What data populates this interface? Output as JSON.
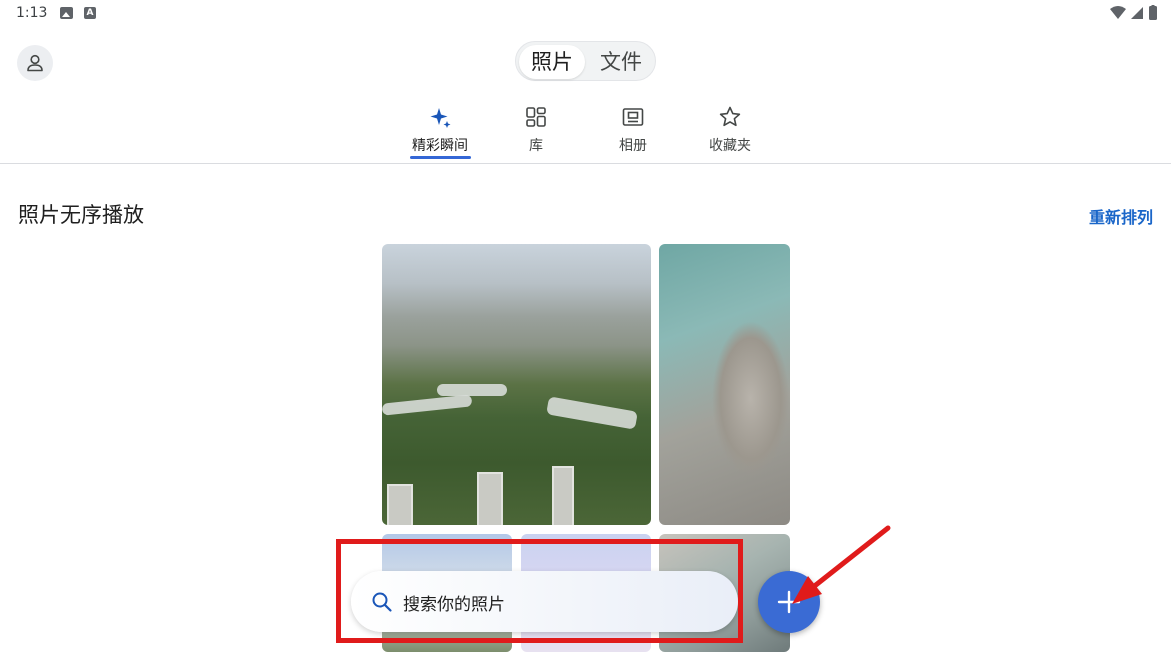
{
  "status_bar": {
    "time": "1:13",
    "icons": [
      "image-notification-icon",
      "a-notification-icon",
      "wifi-icon",
      "cell-signal-icon",
      "battery-icon"
    ]
  },
  "header": {
    "avatar_icon": "person-icon",
    "toggle": {
      "selected": "照片",
      "options": [
        "照片",
        "文件"
      ]
    }
  },
  "tabs": [
    {
      "label": "精彩瞬间",
      "icon": "sparkle-icon",
      "active": true
    },
    {
      "label": "库",
      "icon": "grid-icon",
      "active": false
    },
    {
      "label": "相册",
      "icon": "album-icon",
      "active": false
    },
    {
      "label": "收藏夹",
      "icon": "star-icon",
      "active": false
    }
  ],
  "content": {
    "section_title": "照片无序播放",
    "rearrange_label": "重新排列"
  },
  "search": {
    "placeholder": "搜索你的照片",
    "icon": "search-icon"
  },
  "fab": {
    "icon": "plus-icon"
  },
  "colors": {
    "accent": "#3467d6",
    "link": "#1a66c9",
    "fab": "#3a6bd4",
    "annotation": "#e01b1b"
  }
}
